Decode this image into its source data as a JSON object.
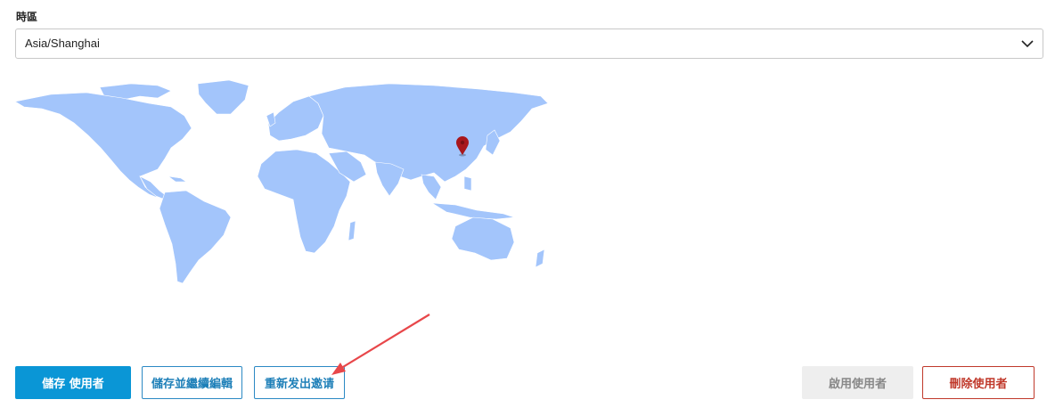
{
  "timezone": {
    "label": "時區",
    "selected": "Asia/Shanghai"
  },
  "map": {
    "land_color": "#a3c5fb",
    "marker_color": "#a8171c",
    "marker_location": "Shanghai"
  },
  "buttons": {
    "save": "儲存 使用者",
    "save_continue": "儲存並繼續編輯",
    "reinvite": "重新发出邀请",
    "enable": "啟用使用者",
    "delete": "刪除使用者"
  },
  "annotation": {
    "arrow_color": "#e8474a",
    "arrow_target": "reinvite-button"
  },
  "colors": {
    "primary": "#0a96d6",
    "danger": "#c0392b",
    "disabled_bg": "#eeeeee"
  }
}
